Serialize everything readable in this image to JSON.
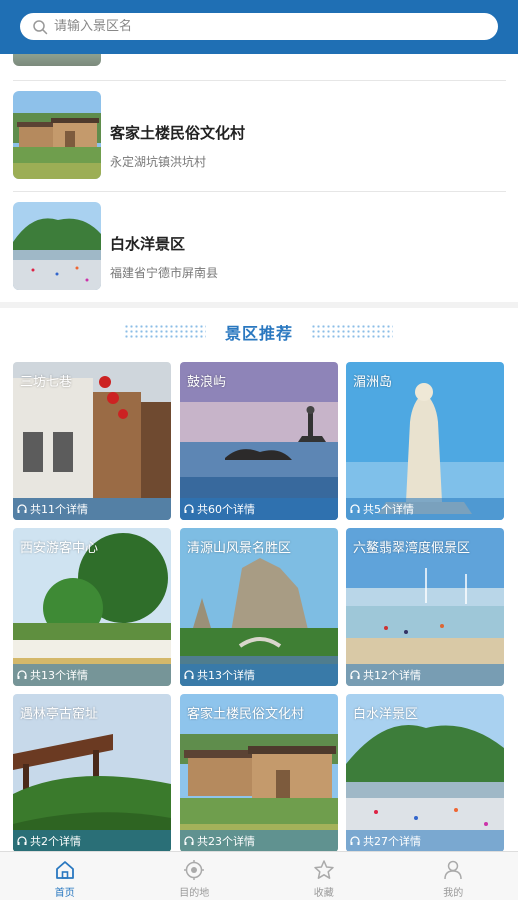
{
  "search": {
    "placeholder": "请输入景区名"
  },
  "list": [
    {
      "name": "客家土楼民俗文化村",
      "address": "永定湖坑镇洪坑村"
    },
    {
      "name": "白水洋景区",
      "address": "福建省宁德市屏南县"
    }
  ],
  "recommend": {
    "title": "景区推荐",
    "tiles": [
      {
        "name": "三坊七巷",
        "count": "共11个详情"
      },
      {
        "name": "鼓浪屿",
        "count": "共60个详情"
      },
      {
        "name": "湄洲岛",
        "count": "共5个详情"
      },
      {
        "name": "西安游客中心",
        "count": "共13个详情"
      },
      {
        "name": "清源山风景名胜区",
        "count": "共13个详情"
      },
      {
        "name": "六鳌翡翠湾度假景区",
        "count": "共12个详情"
      },
      {
        "name": "遇林亭古窑址",
        "count": "共2个详情"
      },
      {
        "name": "客家土楼民俗文化村",
        "count": "共23个详情"
      },
      {
        "name": "白水洋景区",
        "count": "共27个详情"
      }
    ]
  },
  "tabs": [
    {
      "label": "首页",
      "icon": "home-icon",
      "active": true
    },
    {
      "label": "目的地",
      "icon": "location-icon"
    },
    {
      "label": "收藏",
      "icon": "star-icon"
    },
    {
      "label": "我的",
      "icon": "user-icon"
    }
  ],
  "colors": {
    "brand": "#1f6fb4",
    "accent": "#2a78c0"
  }
}
